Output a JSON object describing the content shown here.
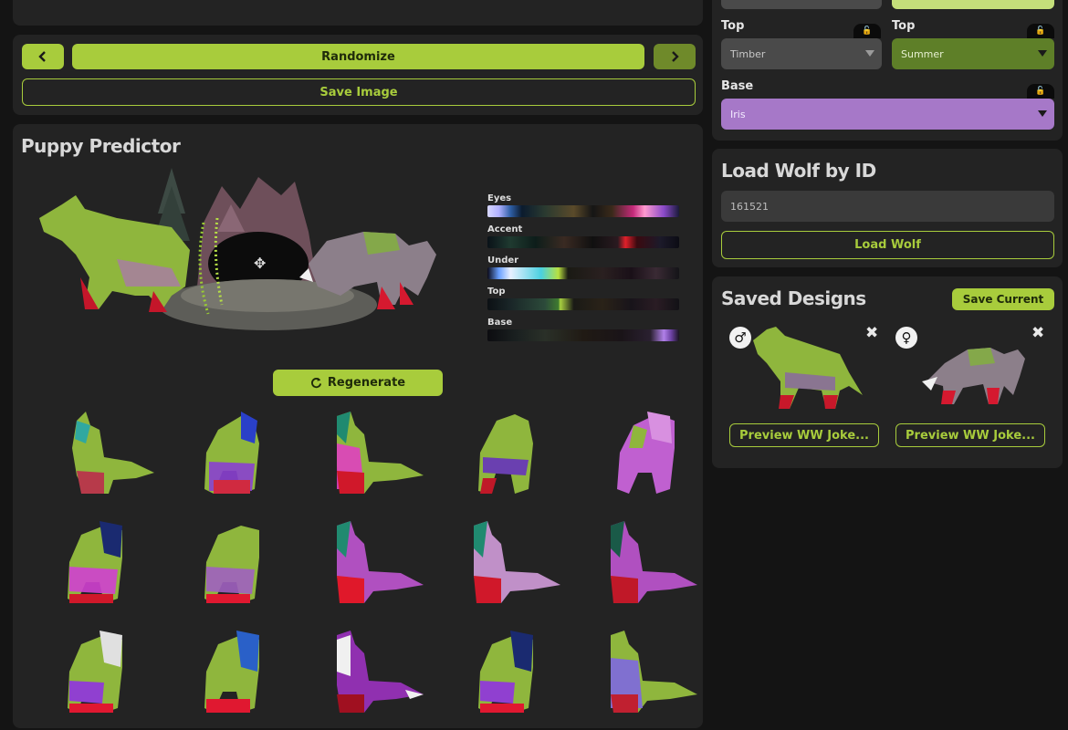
{
  "controls": {
    "prev_icon": "chevron-left-icon",
    "next_icon": "chevron-right-icon",
    "randomize_label": "Randomize",
    "save_image_label": "Save Image"
  },
  "predictor": {
    "title": "Puppy Predictor",
    "palettes": [
      {
        "label": "Eyes"
      },
      {
        "label": "Accent"
      },
      {
        "label": "Under"
      },
      {
        "label": "Top"
      },
      {
        "label": "Base"
      }
    ],
    "regenerate_label": "Regenerate"
  },
  "color_selects": {
    "top_left": {
      "label": "Top",
      "value": "Timber"
    },
    "top_right": {
      "label": "Top",
      "value": "Summer"
    },
    "base": {
      "label": "Base",
      "value": "Iris"
    }
  },
  "load_wolf": {
    "title": "Load Wolf by ID",
    "input_value": "161521",
    "button_label": "Load Wolf"
  },
  "saved_designs": {
    "title": "Saved Designs",
    "save_current_label": "Save Current",
    "items": [
      {
        "sex_symbol": "♂",
        "preview_label": "Preview WW Joke..."
      },
      {
        "sex_symbol": "♀",
        "preview_label": "Preview WW Joke..."
      }
    ]
  },
  "colors": {
    "accent": "#a8cc3c",
    "accent_dark": "#6f8a2a",
    "panel": "#232323",
    "background": "#141414",
    "select_timber": "#4a4a4a",
    "select_summer": "#5e7f28",
    "select_iris": "#a678c8"
  }
}
